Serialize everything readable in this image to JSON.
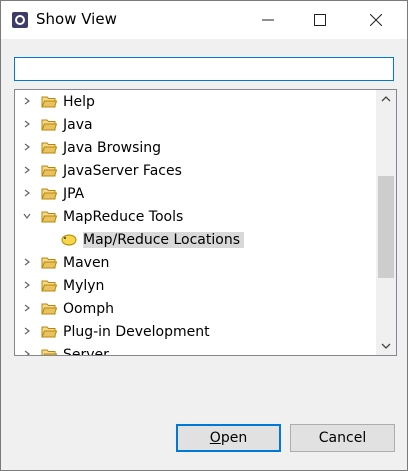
{
  "window": {
    "title": "Show View"
  },
  "filter": {
    "value": "",
    "placeholder": ""
  },
  "tree": {
    "items": [
      {
        "label": "Help",
        "expanded": false
      },
      {
        "label": "Java",
        "expanded": false
      },
      {
        "label": "Java Browsing",
        "expanded": false
      },
      {
        "label": "JavaServer Faces",
        "expanded": false
      },
      {
        "label": "JPA",
        "expanded": false
      },
      {
        "label": "MapReduce Tools",
        "expanded": true
      },
      {
        "label": "Map/Reduce Locations",
        "child": true,
        "selected": true
      },
      {
        "label": "Maven",
        "expanded": false
      },
      {
        "label": "Mylyn",
        "expanded": false
      },
      {
        "label": "Oomph",
        "expanded": false
      },
      {
        "label": "Plug-in Development",
        "expanded": false
      },
      {
        "label": "Server",
        "expanded": false
      }
    ]
  },
  "buttons": {
    "open_first": "O",
    "open_rest": "pen",
    "cancel": "Cancel"
  },
  "colors": {
    "accent": "#0078d7",
    "selection": "#d9d9d9",
    "folder": "#dcb35c"
  }
}
